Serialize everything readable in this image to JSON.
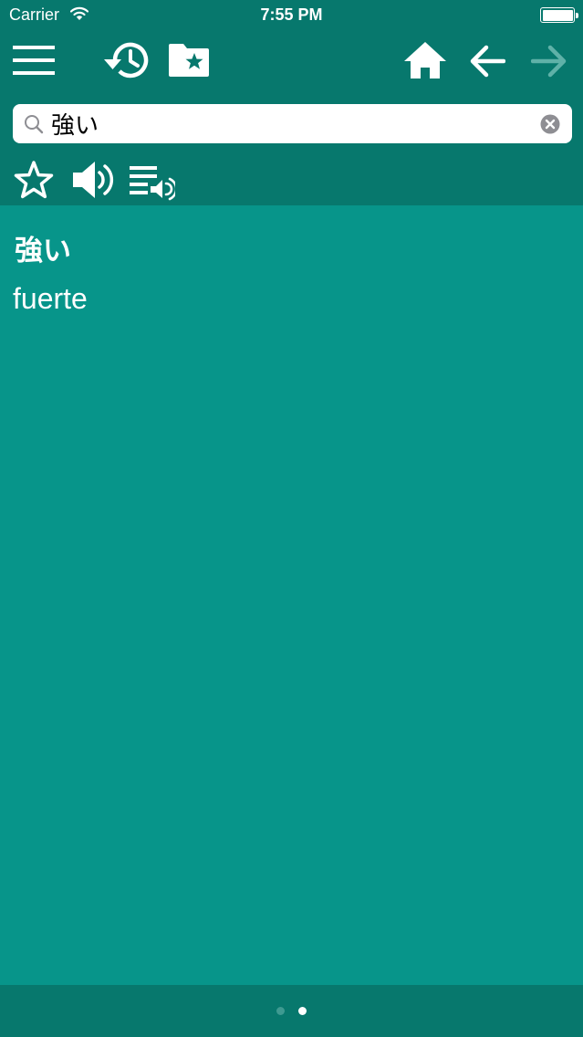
{
  "status_bar": {
    "carrier": "Carrier",
    "time": "7:55 PM",
    "wifi_icon": "wifi-icon",
    "battery_icon": "battery-icon"
  },
  "toolbar": {
    "icons": [
      "menu-icon",
      "history-icon",
      "favorites-folder-icon",
      "home-icon",
      "back-arrow-icon",
      "forward-arrow-icon"
    ],
    "forward_enabled": false
  },
  "search": {
    "value": "強い",
    "placeholder": "",
    "search_icon": "search-icon",
    "clear_icon": "clear-icon"
  },
  "actions": {
    "icons": [
      "star-icon",
      "speaker-icon",
      "playlist-audio-icon"
    ]
  },
  "entry": {
    "term": "強い",
    "translation": "fuerte"
  },
  "pager": {
    "pages": 2,
    "current_page": 2
  },
  "colors": {
    "header_bg": "#07786d",
    "content_bg": "#07958a",
    "foreground": "#ffffff",
    "disabled_icon": "#5fb1a8"
  }
}
